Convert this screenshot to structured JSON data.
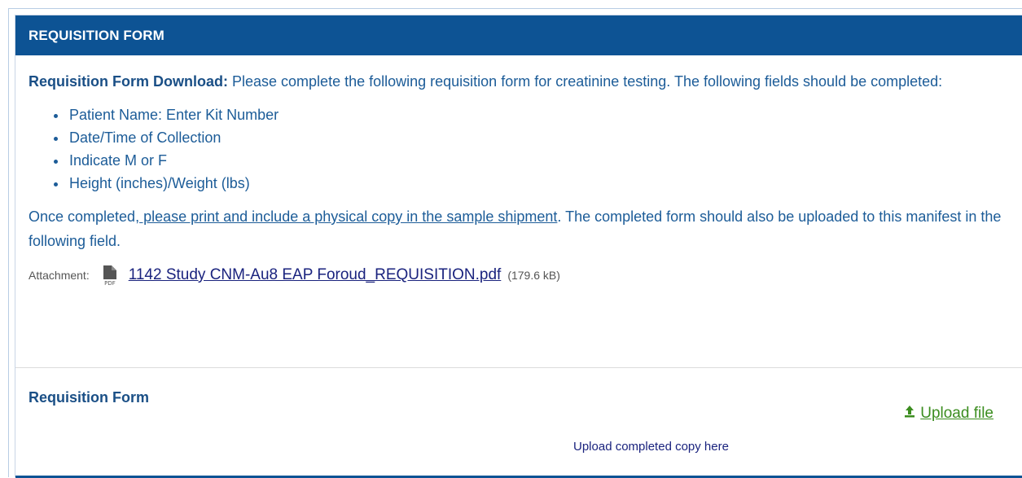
{
  "header": {
    "title": "REQUISITION FORM"
  },
  "intro": {
    "bold": "Requisition Form Download:",
    "text": " Please complete the following requisition form for creatinine testing. The following fields should be completed:"
  },
  "fields": [
    "Patient Name: Enter Kit Number",
    "Date/Time of Collection",
    "Indicate M or F",
    "Height (inches)/Weight (lbs)"
  ],
  "after": {
    "prefix": "Once completed,",
    "link": " please print and include a physical copy in the sample shipment",
    "suffix": ". The completed form should also be uploaded to this manifest in the following field."
  },
  "attachment": {
    "label": "Attachment:",
    "filename": "1142 Study CNM-Au8 EAP Foroud_REQUISITION.pdf",
    "size": "(179.6 kB)",
    "icon": "pdf-file-icon"
  },
  "requisition": {
    "title": "Requisition Form",
    "upload_label": "Upload file",
    "upload_icon": "upload-icon",
    "help": "Upload completed copy here"
  },
  "colors": {
    "header_bg": "#0d5394",
    "text": "#1c5c98",
    "link": "#1a237e",
    "upload": "#3b8d1f"
  }
}
